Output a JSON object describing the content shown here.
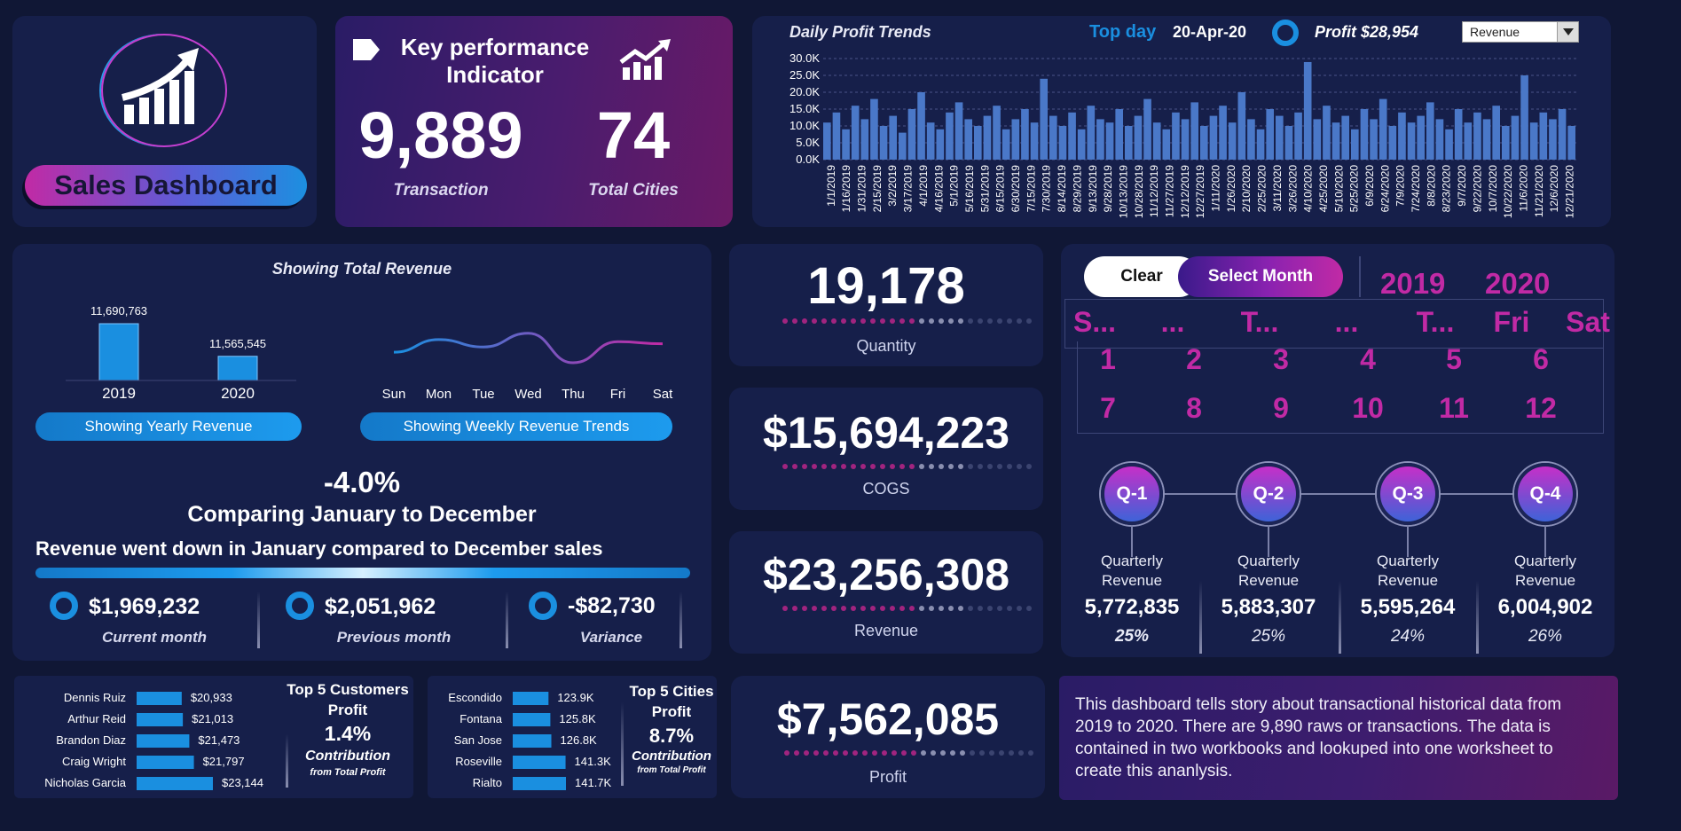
{
  "brand": {
    "title": "Sales Dashboard",
    "logo_icon": "growth-chart-icon"
  },
  "kpi_header": {
    "title_line1": "Key performance",
    "title_line2": "Indicator",
    "transactions": "9,889",
    "transactions_label": "Transaction",
    "cities": "74",
    "cities_label": "Total Cities"
  },
  "daily": {
    "title": "Daily Profit Trends",
    "top_day_label": "Top day",
    "top_day_date": "20-Apr-20",
    "profit_text": "Profit $28,954",
    "dropdown_value": "Revenue"
  },
  "revenue_panel": {
    "title": "Showing Total  Revenue",
    "yearly_button": "Showing Yearly  Revenue",
    "weekly_button": "Showing Weekly  Revenue Trends",
    "pct_change": "-4.0%",
    "comparing": "Comparing January to December",
    "statement": "Revenue went down in January compared to December sales",
    "current_value": "$1,969,232",
    "current_label": "Current month",
    "previous_value": "$2,051,962",
    "previous_label": "Previous month",
    "variance_value": "-$82,730",
    "variance_label": "Variance"
  },
  "kpis": {
    "quantity": "19,178",
    "quantity_label": "Quantity",
    "cogs": "$15,694,223",
    "cogs_label": "COGS",
    "revenue": "$23,256,308",
    "revenue_label": "Revenue",
    "profit": "$7,562,085",
    "profit_label": "Profit"
  },
  "calendar": {
    "clear_button": "Clear",
    "select_month_button": "Select Month",
    "years": [
      "2019",
      "2020"
    ],
    "days": [
      "S...",
      "...",
      "T...",
      "...",
      "T...",
      "Fri",
      "Sat"
    ],
    "months": [
      "1",
      "2",
      "3",
      "4",
      "5",
      "6",
      "7",
      "8",
      "9",
      "10",
      "11",
      "12"
    ]
  },
  "quarters": {
    "label_line1": "Quarterly",
    "label_line2": "Revenue",
    "items": [
      {
        "name": "Q-1",
        "value": "5,772,835",
        "pct": "25%"
      },
      {
        "name": "Q-2",
        "value": "5,883,307",
        "pct": "25%"
      },
      {
        "name": "Q-3",
        "value": "5,595,264",
        "pct": "24%"
      },
      {
        "name": "Q-4",
        "value": "6,004,902",
        "pct": "26%"
      }
    ]
  },
  "customers": {
    "title_line1": "Top 5 Customers",
    "title_line2": "Profit",
    "pct": "1.4%",
    "contribution": "Contribution",
    "from": "from Total Profit"
  },
  "cities": {
    "title_line1": "Top 5 Cities",
    "title_line2": "Profit",
    "pct": "8.7%",
    "contribution": "Contribution",
    "from": "from Total Profit"
  },
  "story": "This dashboard tells story about transactional historical data from 2019 to 2020. There are 9,890 raws or transactions. The data is contained in two workbooks and lookuped into one worksheet to create this ananlysis.",
  "colors": {
    "bg": "#101735",
    "panel": "#161f4a",
    "accent_blue": "#1a8fe0",
    "accent_magenta": "#c12aa5"
  },
  "chart_data": [
    {
      "id": "daily",
      "type": "bar",
      "yticks": [
        "0.0K",
        "5.0K",
        "10.0K",
        "15.0K",
        "20.0K",
        "25.0K",
        "30.0K"
      ],
      "ylim": [
        0,
        30000
      ],
      "xticks": [
        "1/1/2019",
        "1/16/2019",
        "1/31/2019",
        "2/15/2019",
        "3/2/2019",
        "3/17/2019",
        "4/1/2019",
        "4/16/2019",
        "5/1/2019",
        "5/16/2019",
        "5/31/2019",
        "6/15/2019",
        "6/30/2019",
        "7/15/2019",
        "7/30/2019",
        "8/14/2019",
        "8/29/2019",
        "9/13/2019",
        "9/28/2019",
        "10/13/2019",
        "10/28/2019",
        "11/12/2019",
        "11/27/2019",
        "12/12/2019",
        "12/27/2019",
        "1/11/2020",
        "1/26/2020",
        "2/10/2020",
        "2/25/2020",
        "3/11/2020",
        "3/26/2020",
        "4/10/2020",
        "4/25/2020",
        "5/10/2020",
        "5/25/2020",
        "6/9/2020",
        "6/24/2020",
        "7/9/2020",
        "7/24/2020",
        "8/8/2020",
        "8/23/2020",
        "9/7/2020",
        "9/22/2020",
        "10/7/2020",
        "10/22/2020",
        "11/6/2020",
        "11/21/2020",
        "12/6/2020",
        "12/21/2020"
      ],
      "values": [
        11000,
        14000,
        9000,
        16000,
        12000,
        18000,
        10000,
        13000,
        8000,
        15000,
        20000,
        11000,
        9000,
        14000,
        17000,
        12000,
        10000,
        13000,
        16000,
        9000,
        12000,
        15000,
        11000,
        24000,
        13000,
        10000,
        14000,
        9000,
        16000,
        12000,
        11000,
        15000,
        10000,
        13000,
        18000,
        11000,
        9000,
        14000,
        12000,
        17000,
        10000,
        13000,
        16000,
        11000,
        20000,
        12000,
        9000,
        15000,
        13000,
        10000,
        14000,
        28954,
        12000,
        16000,
        11000,
        13000,
        9000,
        15000,
        12000,
        18000,
        10000,
        14000,
        11000,
        13000,
        17000,
        12000,
        9000,
        15000,
        11000,
        14000,
        12000,
        16000,
        10000,
        13000,
        25000,
        11000,
        14000,
        12000,
        15000,
        10000
      ]
    },
    {
      "id": "yearly",
      "type": "bar",
      "categories": [
        "2019",
        "2020"
      ],
      "values": [
        11690763,
        11565545
      ],
      "labels": [
        "11,690,763",
        "11,565,545"
      ]
    },
    {
      "id": "weekly",
      "type": "line",
      "categories": [
        "Sun",
        "Mon",
        "Tue",
        "Wed",
        "Thu",
        "Fri",
        "Sat"
      ],
      "values": [
        3300000,
        3420000,
        3350000,
        3480000,
        3200000,
        3400000,
        3380000
      ]
    },
    {
      "id": "customers",
      "type": "bar",
      "categories": [
        "Dennis Ruiz",
        "Arthur Reid",
        "Brandon Diaz",
        "Craig Wright",
        "Nicholas Garcia"
      ],
      "values": [
        20933,
        21013,
        21473,
        21797,
        23144
      ],
      "labels": [
        "$20,933",
        "$21,013",
        "$21,473",
        "$21,797",
        "$23,144"
      ]
    },
    {
      "id": "cities",
      "type": "bar",
      "categories": [
        "Escondido",
        "Fontana",
        "San Jose",
        "Roseville",
        "Rialto"
      ],
      "values": [
        123900,
        125800,
        126800,
        141300,
        141700
      ],
      "labels": [
        "123.9K",
        "125.8K",
        "126.8K",
        "141.3K",
        "141.7K"
      ]
    }
  ]
}
